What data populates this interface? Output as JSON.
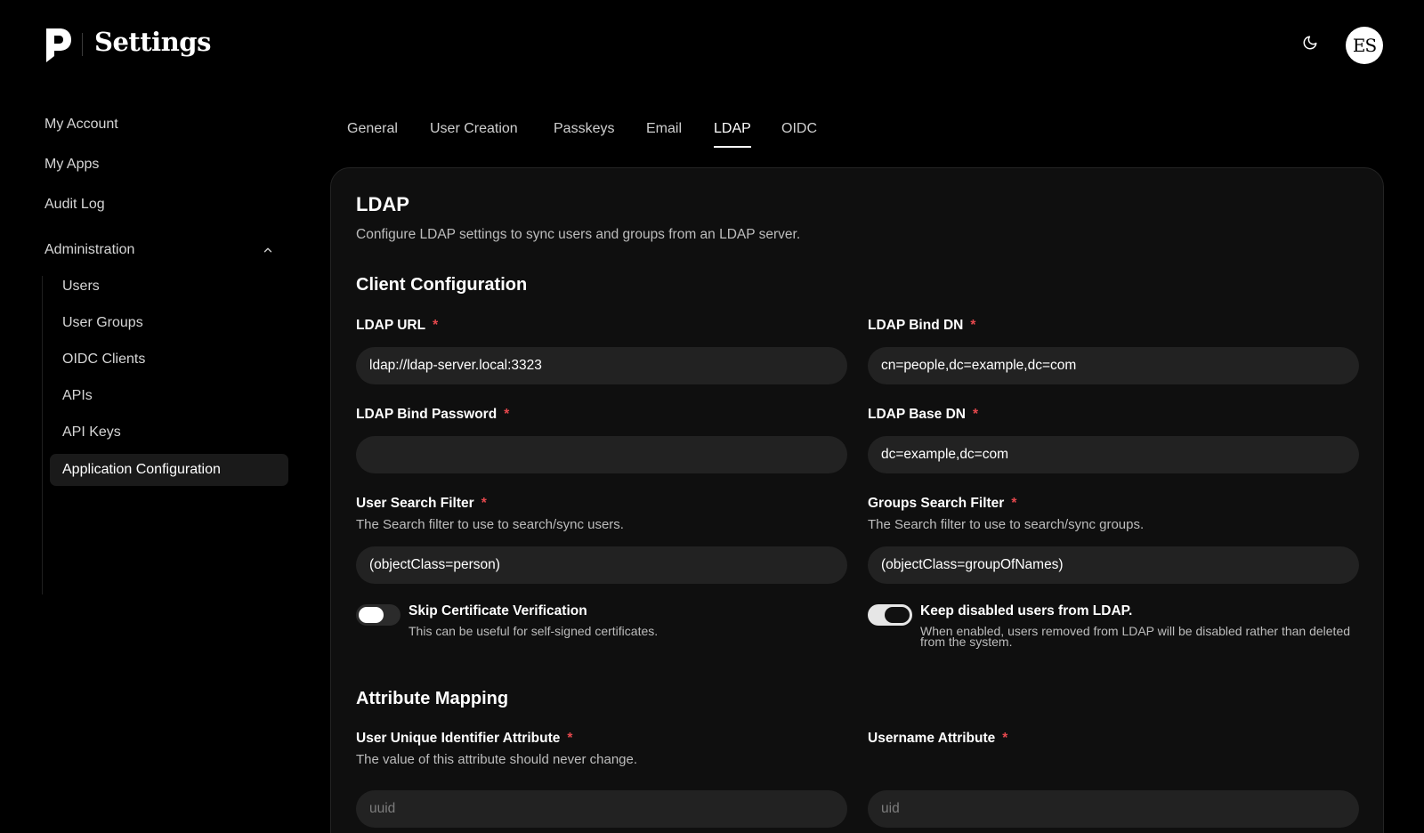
{
  "header": {
    "app_title": "Settings",
    "avatar_initials": "ES",
    "icons": {
      "logo": "pocket-id-logo",
      "theme": "moon-icon"
    }
  },
  "sidebar": {
    "items": [
      {
        "label": "My Account"
      },
      {
        "label": "My Apps"
      },
      {
        "label": "Audit Log"
      }
    ],
    "administration": {
      "label": "Administration",
      "expanded": true,
      "items": [
        {
          "label": "Users"
        },
        {
          "label": "User Groups"
        },
        {
          "label": "OIDC Clients"
        },
        {
          "label": "APIs"
        },
        {
          "label": "API Keys"
        },
        {
          "label": "Application Configuration",
          "active": true
        }
      ]
    }
  },
  "tabs": [
    {
      "label": "General"
    },
    {
      "label": "User Creation"
    },
    {
      "label": "Passkeys"
    },
    {
      "label": "Email"
    },
    {
      "label": "LDAP",
      "active": true
    },
    {
      "label": "OIDC"
    }
  ],
  "card": {
    "title": "LDAP",
    "description": "Configure LDAP settings to sync users and groups from an LDAP server.",
    "client_config": {
      "title": "Client Configuration",
      "ldap_url": {
        "label": "LDAP URL",
        "required_mark": "*",
        "value": "ldap://ldap-server.local:3323"
      },
      "bind_dn": {
        "label": "LDAP Bind DN",
        "required_mark": "*",
        "value": "cn=people,dc=example,dc=com"
      },
      "bind_password": {
        "label": "LDAP Bind Password",
        "required_mark": "*",
        "value": ""
      },
      "base_dn": {
        "label": "LDAP Base DN",
        "required_mark": "*",
        "value": "dc=example,dc=com"
      },
      "user_filter": {
        "label": "User Search Filter",
        "required_mark": "*",
        "help": "The Search filter to use to search/sync users.",
        "value": "(objectClass=person)"
      },
      "group_filter": {
        "label": "Groups Search Filter",
        "required_mark": "*",
        "help": "The Search filter to use to search/sync groups.",
        "value": "(objectClass=groupOfNames)"
      },
      "skip_cert": {
        "label": "Skip Certificate Verification",
        "help": "This can be useful for self-signed certificates.",
        "enabled": false
      },
      "keep_disabled": {
        "label": "Keep disabled users from LDAP.",
        "help": "When enabled, users removed from LDAP will be disabled rather than deleted from the system.",
        "enabled": true
      }
    },
    "attribute_mapping": {
      "title": "Attribute Mapping",
      "unique_id": {
        "label": "User Unique Identifier Attribute",
        "required_mark": "*",
        "help": "The value of this attribute should never change.",
        "placeholder": "uuid"
      },
      "username": {
        "label": "Username Attribute",
        "required_mark": "*",
        "placeholder": "uid"
      }
    }
  },
  "colors": {
    "background": "#000000",
    "card": "#0f0f0f",
    "input": "#222222",
    "required": "#e5484d",
    "text": "#ffffff",
    "muted_text": "#bdbdbd"
  }
}
